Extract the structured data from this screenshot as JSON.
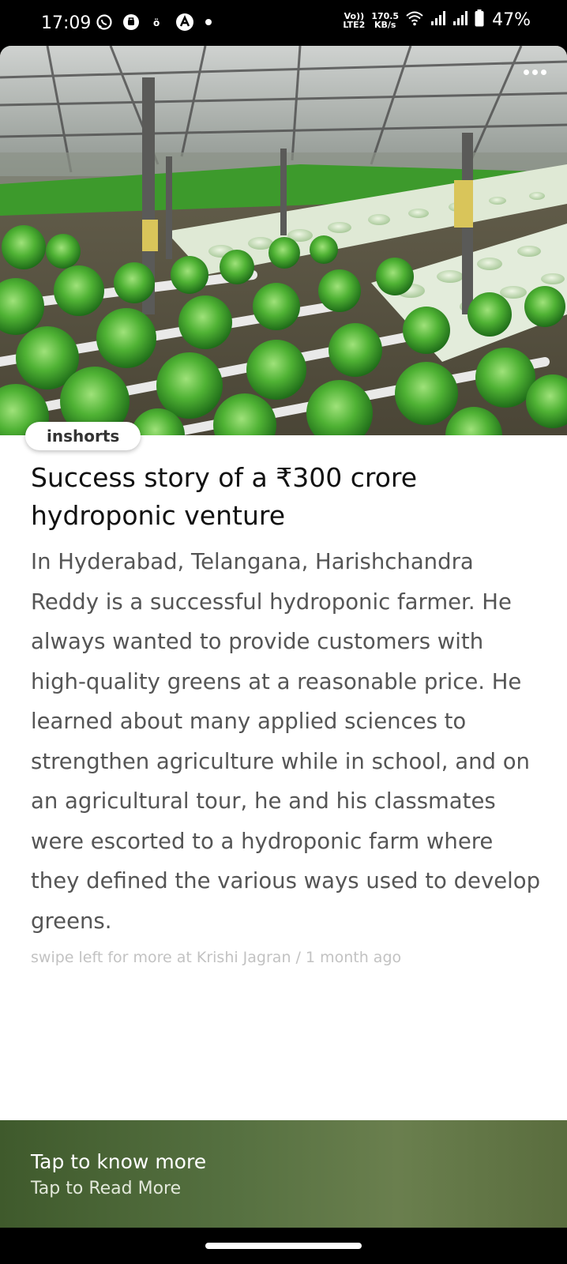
{
  "status_bar": {
    "time": "17:09",
    "left_icons": [
      "whatsapp-icon",
      "notification-icon",
      "sim-icon",
      "app-icon"
    ],
    "volte": "Vo))",
    "lte": "LTE2",
    "speed_value": "170.5",
    "speed_unit": "KB/s",
    "battery": "47%"
  },
  "article": {
    "brand": "inshorts",
    "headline": "Success story of a ₹300 crore hydroponic venture",
    "body": "In Hyderabad, Telangana, Harishchandra Reddy is a successful hydroponic farmer. He always wanted to provide customers with high-quality greens at a reasonable price. He learned about many applied sciences to strengthen agriculture while in school, and on an agricultural tour, he and his classmates were escorted to a hydroponic farm where they defined the various ways used to develop greens.",
    "meta": "swipe left for more at Krishi Jagran / 1 month ago"
  },
  "footer": {
    "title": "Tap to know more",
    "subtitle": "Tap to Read More"
  },
  "colors": {
    "footer_bg": "#557040",
    "greens": "#3fa52a"
  }
}
